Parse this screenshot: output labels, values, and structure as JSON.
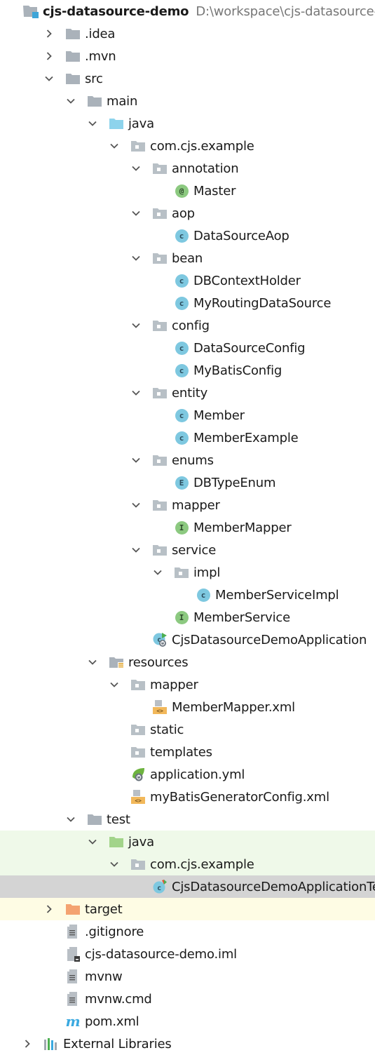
{
  "colors": {
    "folder_gray": "#aab2ba",
    "folder_blue": "#8dd3ec",
    "folder_green": "#a2d48a",
    "folder_orange": "#f4a371",
    "class_blue": "#7ec8e0",
    "interface_green": "#8cc980",
    "test_row_bg": "#eff9e9",
    "selected_row_bg": "#d4d4d4",
    "excluded_row_bg": "#fefce4"
  },
  "project": {
    "name": "cjs-datasource-demo",
    "path": "D:\\workspace\\cjs-datasource-de"
  },
  "tree": [
    {
      "label": ".idea",
      "icon": "folder-icon",
      "depth": 1,
      "chevron": "right"
    },
    {
      "label": ".mvn",
      "icon": "folder-icon",
      "depth": 1,
      "chevron": "right"
    },
    {
      "label": "src",
      "icon": "folder-icon",
      "depth": 1,
      "chevron": "down"
    },
    {
      "label": "main",
      "icon": "folder-icon",
      "depth": 2,
      "chevron": "down"
    },
    {
      "label": "java",
      "icon": "source-folder-icon",
      "depth": 3,
      "chevron": "down"
    },
    {
      "label": "com.cjs.example",
      "icon": "package-icon",
      "depth": 4,
      "chevron": "down"
    },
    {
      "label": "annotation",
      "icon": "package-icon",
      "depth": 5,
      "chevron": "down"
    },
    {
      "label": "Master",
      "icon": "annotation-icon",
      "depth": 6,
      "chevron": "none"
    },
    {
      "label": "aop",
      "icon": "package-icon",
      "depth": 5,
      "chevron": "down"
    },
    {
      "label": "DataSourceAop",
      "icon": "class-icon",
      "depth": 6,
      "chevron": "none"
    },
    {
      "label": "bean",
      "icon": "package-icon",
      "depth": 5,
      "chevron": "down"
    },
    {
      "label": "DBContextHolder",
      "icon": "class-icon",
      "depth": 6,
      "chevron": "none"
    },
    {
      "label": "MyRoutingDataSource",
      "icon": "class-icon",
      "depth": 6,
      "chevron": "none"
    },
    {
      "label": "config",
      "icon": "package-icon",
      "depth": 5,
      "chevron": "down"
    },
    {
      "label": "DataSourceConfig",
      "icon": "class-icon",
      "depth": 6,
      "chevron": "none"
    },
    {
      "label": "MyBatisConfig",
      "icon": "class-icon",
      "depth": 6,
      "chevron": "none"
    },
    {
      "label": "entity",
      "icon": "package-icon",
      "depth": 5,
      "chevron": "down"
    },
    {
      "label": "Member",
      "icon": "class-icon",
      "depth": 6,
      "chevron": "none"
    },
    {
      "label": "MemberExample",
      "icon": "class-icon",
      "depth": 6,
      "chevron": "none"
    },
    {
      "label": "enums",
      "icon": "package-icon",
      "depth": 5,
      "chevron": "down"
    },
    {
      "label": "DBTypeEnum",
      "icon": "enum-icon",
      "depth": 6,
      "chevron": "none"
    },
    {
      "label": "mapper",
      "icon": "package-icon",
      "depth": 5,
      "chevron": "down"
    },
    {
      "label": "MemberMapper",
      "icon": "interface-icon",
      "depth": 6,
      "chevron": "none"
    },
    {
      "label": "service",
      "icon": "package-icon",
      "depth": 5,
      "chevron": "down"
    },
    {
      "label": "impl",
      "icon": "package-icon",
      "depth": 6,
      "chevron": "down"
    },
    {
      "label": "MemberServiceImpl",
      "icon": "class-icon",
      "depth": 7,
      "chevron": "none"
    },
    {
      "label": "MemberService",
      "icon": "interface-icon",
      "depth": 6,
      "chevron": "none"
    },
    {
      "label": "CjsDatasourceDemoApplication",
      "icon": "spring-boot-class-icon",
      "depth": 5,
      "chevron": "none"
    },
    {
      "label": "resources",
      "icon": "resources-folder-icon",
      "depth": 3,
      "chevron": "down"
    },
    {
      "label": "mapper",
      "icon": "package-icon",
      "depth": 4,
      "chevron": "down"
    },
    {
      "label": "MemberMapper.xml",
      "icon": "xml-file-icon",
      "depth": 5,
      "chevron": "none"
    },
    {
      "label": "static",
      "icon": "package-icon",
      "depth": 4,
      "chevron": "none"
    },
    {
      "label": "templates",
      "icon": "package-icon",
      "depth": 4,
      "chevron": "none"
    },
    {
      "label": "application.yml",
      "icon": "spring-yml-icon",
      "depth": 4,
      "chevron": "none"
    },
    {
      "label": "myBatisGeneratorConfig.xml",
      "icon": "xml-file-icon",
      "depth": 4,
      "chevron": "none"
    },
    {
      "label": "test",
      "icon": "folder-icon",
      "depth": 2,
      "chevron": "down"
    },
    {
      "label": "java",
      "icon": "test-folder-icon",
      "depth": 3,
      "chevron": "down",
      "state": "test"
    },
    {
      "label": "com.cjs.example",
      "icon": "package-icon",
      "depth": 4,
      "chevron": "down",
      "state": "test"
    },
    {
      "label": "CjsDatasourceDemoApplicationTests",
      "icon": "test-class-icon",
      "depth": 5,
      "chevron": "none",
      "state": "selected"
    },
    {
      "label": "target",
      "icon": "excluded-folder-icon",
      "depth": 1,
      "chevron": "right",
      "state": "excluded"
    },
    {
      "label": ".gitignore",
      "icon": "text-file-icon",
      "depth": 1,
      "chevron": "none"
    },
    {
      "label": "cjs-datasource-demo.iml",
      "icon": "module-file-icon",
      "depth": 1,
      "chevron": "none"
    },
    {
      "label": "mvnw",
      "icon": "text-file-icon",
      "depth": 1,
      "chevron": "none"
    },
    {
      "label": "mvnw.cmd",
      "icon": "text-file-icon",
      "depth": 1,
      "chevron": "none"
    },
    {
      "label": "pom.xml",
      "icon": "maven-icon",
      "depth": 1,
      "chevron": "none"
    },
    {
      "label": "External Libraries",
      "icon": "libraries-icon",
      "depth": 0,
      "chevron": "right"
    }
  ]
}
